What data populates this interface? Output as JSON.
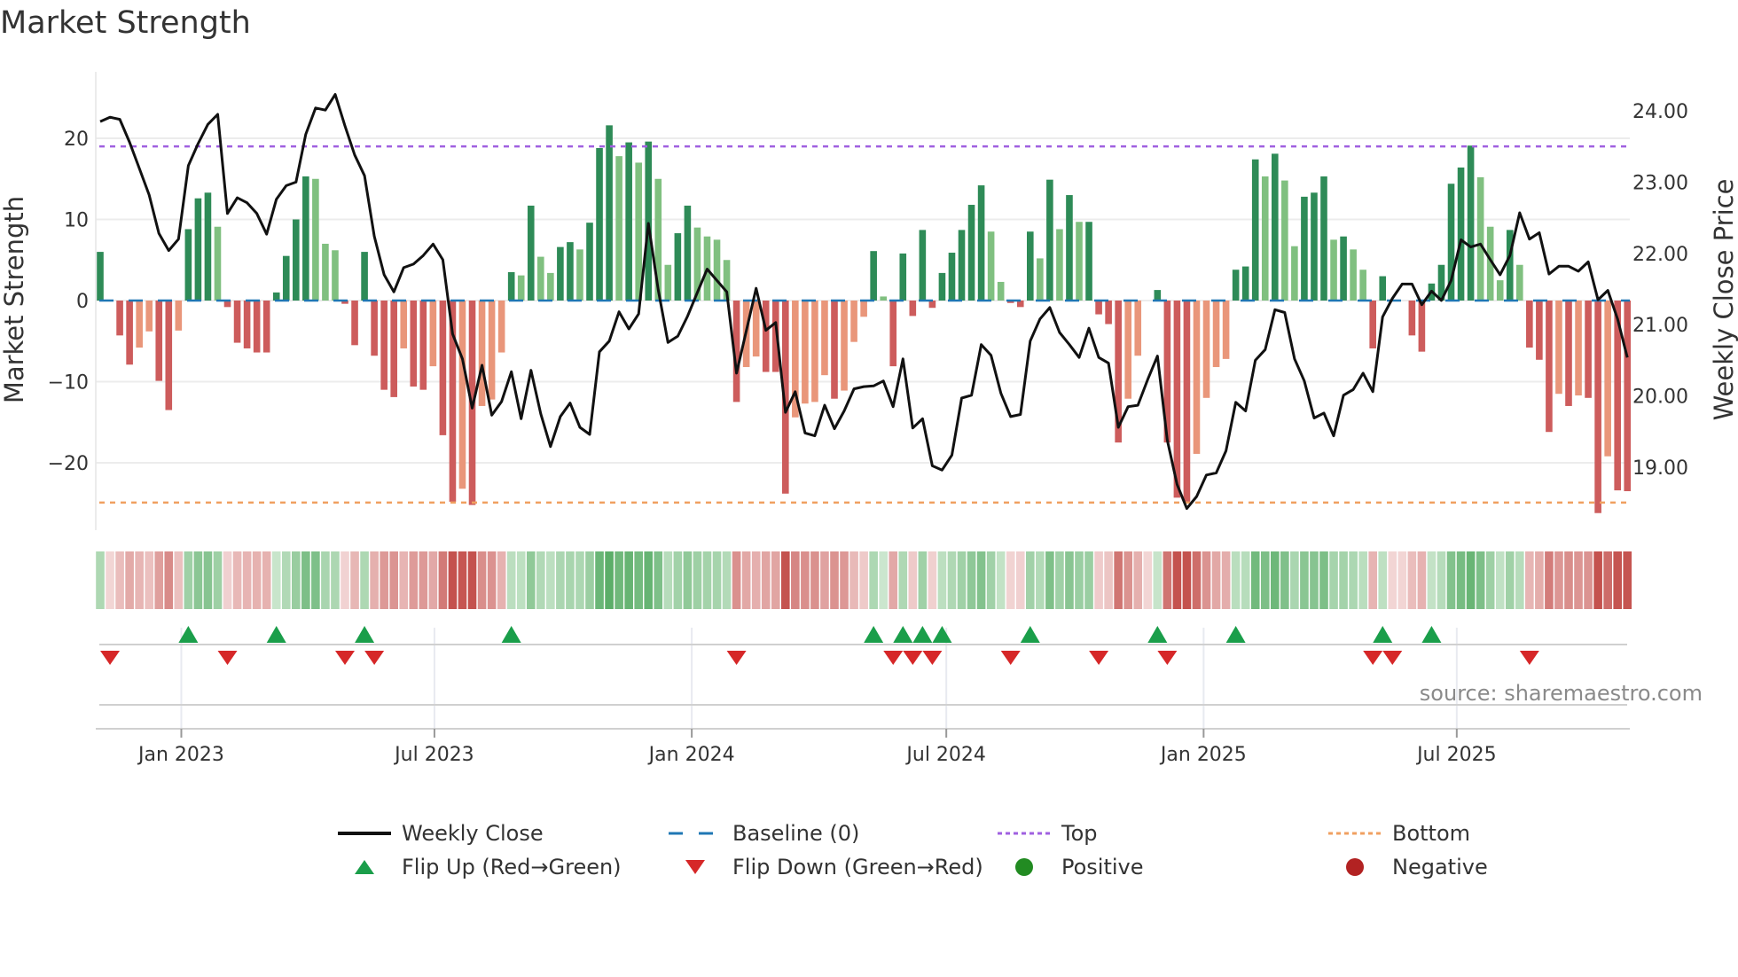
{
  "title": "Market Strength",
  "source": "source: sharemaestro.com",
  "legend": {
    "weekly_close": "Weekly Close",
    "baseline": "Baseline (0)",
    "top": "Top",
    "bottom": "Bottom",
    "flip_up": "Flip Up (Red→Green)",
    "flip_down": "Flip Down (Green→Red)",
    "positive": "Positive",
    "negative": "Negative"
  },
  "colors": {
    "strong_green": "#2e8b57",
    "fading_green": "#80c080",
    "strong_red": "#cd5c5c",
    "fading_red": "#e9967a",
    "close_line": "#111111",
    "baseline": "#1f77b4",
    "top": "#a060e0",
    "bottom": "#f0a060",
    "flip_up": "#1a9e4a",
    "flip_down": "#d62728",
    "positive": "#228b22",
    "negative": "#b22222"
  },
  "chart_data": {
    "type": "bar+line",
    "title": "Market Strength",
    "ylabel_left": "Market Strength",
    "ylabel_right": "Weekly Close Price",
    "ylim_left": [
      -27,
      27
    ],
    "ylim_right": [
      18.27,
      24.68
    ],
    "left_ticks": [
      {
        "v": 20,
        "label": "20"
      },
      {
        "v": 10,
        "label": "10"
      },
      {
        "v": 0,
        "label": "0"
      },
      {
        "v": -10,
        "label": "−10"
      },
      {
        "v": -20,
        "label": "−20"
      }
    ],
    "right_ticks": [
      {
        "v": 24,
        "label": "24.00"
      },
      {
        "v": 23,
        "label": "23.00"
      },
      {
        "v": 22,
        "label": "22.00"
      },
      {
        "v": 21,
        "label": "21.00"
      },
      {
        "v": 20,
        "label": "20.00"
      },
      {
        "v": 19,
        "label": "19.00"
      }
    ],
    "x_ticks": [
      {
        "date": "2023-01-01",
        "label": "Jan 2023"
      },
      {
        "date": "2023-07-01",
        "label": "Jul 2023"
      },
      {
        "date": "2024-01-01",
        "label": "Jan 2024"
      },
      {
        "date": "2024-07-01",
        "label": "Jul 2024"
      },
      {
        "date": "2025-01-01",
        "label": "Jan 2025"
      },
      {
        "date": "2025-07-01",
        "label": "Jul 2025"
      }
    ],
    "first_week": "2022-11-04",
    "top_level": 19.0,
    "bottom_level": -24.9,
    "baseline": 0,
    "strength": [
      6.0,
      0,
      -4.3,
      -7.9,
      -5.8,
      -3.8,
      -9.9,
      -13.5,
      -3.7,
      8.8,
      12.6,
      13.3,
      9.1,
      -0.8,
      -5.2,
      -5.9,
      -6.4,
      -6.4,
      1.0,
      5.5,
      10.0,
      15.3,
      15.0,
      7.0,
      6.2,
      -0.4,
      -5.5,
      6.0,
      -6.8,
      -11.0,
      -11.9,
      -5.9,
      -10.6,
      -11.0,
      -8.1,
      -16.6,
      -24.8,
      -23.2,
      -25.2,
      -13.0,
      -12.2,
      -6.4,
      3.5,
      3.1,
      11.7,
      5.4,
      3.4,
      6.6,
      7.2,
      6.3,
      9.6,
      18.8,
      21.6,
      17.8,
      19.5,
      17.0,
      19.6,
      15.0,
      4.4,
      8.3,
      11.7,
      9.0,
      7.9,
      7.5,
      5.0,
      -12.5,
      -8.2,
      -6.9,
      -8.8,
      -8.8,
      -23.8,
      -14.4,
      -12.7,
      -12.5,
      -9.2,
      -12.1,
      -11.1,
      -5.1,
      -2.0,
      6.1,
      0.5,
      -8.1,
      5.8,
      -1.9,
      8.7,
      -0.9,
      3.4,
      5.9,
      8.7,
      11.8,
      14.2,
      8.5,
      2.3,
      -0.3,
      -0.8,
      8.5,
      5.2,
      14.9,
      8.8,
      13.0,
      9.7,
      9.7,
      -1.7,
      -2.9,
      -17.5,
      -12.1,
      -6.8,
      0,
      1.3,
      -17.5,
      -24.3,
      -24.8,
      -18.9,
      -12.0,
      -8.2,
      -7.2,
      3.8,
      4.2,
      17.4,
      15.3,
      18.1,
      14.8,
      6.7,
      12.8,
      13.3,
      15.3,
      7.5,
      7.9,
      6.3,
      3.8,
      -5.9,
      3.0,
      0,
      0,
      -4.3,
      -6.3,
      2.1,
      4.4,
      14.4,
      16.4,
      19.1,
      15.2,
      9.1,
      2.5,
      8.7,
      4.4,
      -5.8,
      -7.3,
      -16.2,
      -11.5,
      -13.0,
      -11.7,
      -12.0,
      -26.2,
      -19.2,
      -23.4,
      -23.5
    ],
    "weekly_close": [
      23.85,
      23.91,
      23.88,
      23.56,
      23.19,
      22.82,
      22.28,
      22.04,
      22.2,
      23.23,
      23.54,
      23.81,
      23.95,
      22.56,
      22.78,
      22.71,
      22.56,
      22.27,
      22.76,
      22.95,
      23.0,
      23.67,
      24.04,
      24.01,
      24.23,
      23.79,
      23.38,
      23.09,
      22.24,
      21.7,
      21.46,
      21.8,
      21.85,
      21.97,
      22.13,
      21.91,
      20.87,
      20.52,
      19.83,
      20.43,
      19.73,
      19.92,
      20.34,
      19.68,
      20.36,
      19.75,
      19.29,
      19.71,
      19.9,
      19.56,
      19.46,
      20.62,
      20.77,
      21.18,
      20.94,
      21.15,
      22.42,
      21.49,
      20.75,
      20.84,
      21.12,
      21.45,
      21.78,
      21.62,
      21.46,
      20.32,
      20.91,
      21.51,
      20.92,
      21.03,
      19.77,
      20.06,
      19.48,
      19.44,
      19.87,
      19.54,
      19.79,
      20.1,
      20.13,
      20.14,
      20.21,
      19.85,
      20.52,
      19.55,
      19.68,
      19.02,
      18.96,
      19.17,
      19.97,
      20.01,
      20.72,
      20.57,
      20.04,
      19.71,
      19.74,
      20.77,
      21.08,
      21.24,
      20.89,
      20.72,
      20.54,
      20.95,
      20.54,
      20.46,
      19.56,
      19.85,
      19.87,
      20.23,
      20.56,
      19.38,
      18.76,
      18.42,
      18.59,
      18.89,
      18.92,
      19.23,
      19.91,
      19.79,
      20.5,
      20.65,
      21.21,
      21.17,
      20.52,
      20.21,
      19.69,
      19.76,
      19.44,
      20.01,
      20.09,
      20.32,
      20.06,
      21.11,
      21.37,
      21.57,
      21.57,
      21.28,
      21.47,
      21.34,
      21.62,
      22.19,
      22.09,
      22.13,
      21.91,
      21.7,
      21.97,
      22.57,
      22.2,
      22.29,
      21.71,
      21.82,
      21.82,
      21.75,
      21.88,
      21.35,
      21.48,
      21.08,
      20.54
    ]
  }
}
